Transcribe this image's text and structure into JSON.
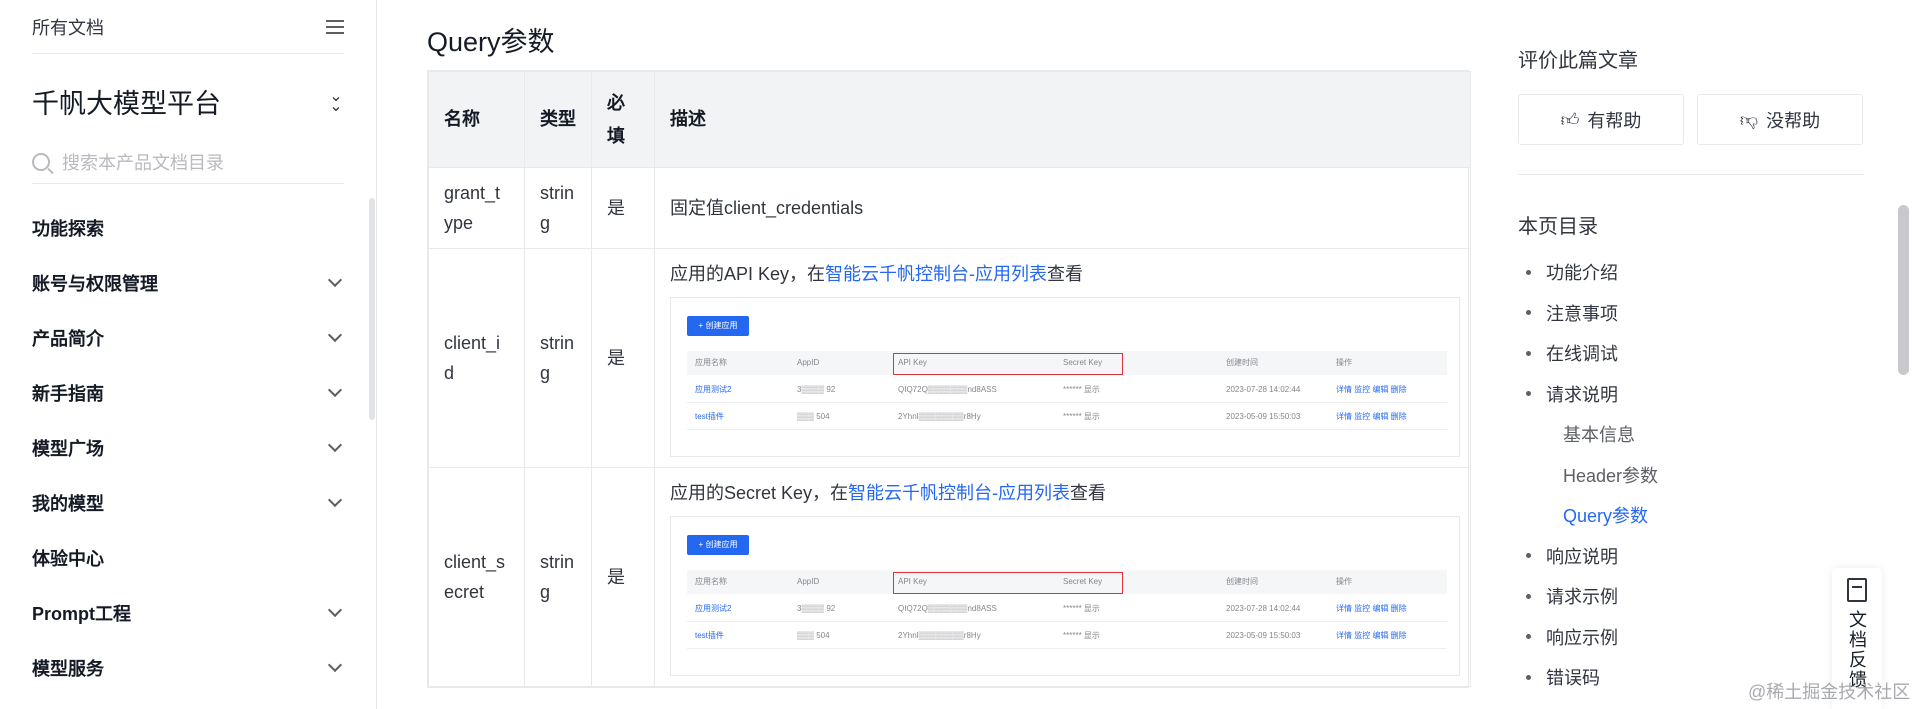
{
  "sidebar": {
    "top_label": "所有文档",
    "product_title": "千帆大模型平台",
    "search_placeholder": "搜索本产品文档目录",
    "items": [
      {
        "label": "功能探索",
        "expandable": false
      },
      {
        "label": "账号与权限管理",
        "expandable": true
      },
      {
        "label": "产品简介",
        "expandable": true
      },
      {
        "label": "新手指南",
        "expandable": true
      },
      {
        "label": "模型广场",
        "expandable": true
      },
      {
        "label": "我的模型",
        "expandable": true
      },
      {
        "label": "体验中心",
        "expandable": false
      },
      {
        "label": "Prompt工程",
        "expandable": true
      },
      {
        "label": "模型服务",
        "expandable": true
      }
    ]
  },
  "main": {
    "section_title": "Query参数",
    "table": {
      "headers": [
        "名称",
        "类型",
        "必填",
        "描述"
      ],
      "rows": [
        {
          "name": "grant_type",
          "type": "string",
          "required": "是",
          "desc_text": "固定值client_credentials"
        },
        {
          "name": "client_id",
          "type": "string",
          "required": "是",
          "desc_prefix": "应用的API Key，在",
          "desc_link": "智能云千帆控制台-应用列表",
          "desc_suffix": "查看"
        },
        {
          "name": "client_secret",
          "type": "string",
          "required": "是",
          "desc_prefix": "应用的Secret Key，在",
          "desc_link": "智能云千帆控制台-应用列表",
          "desc_suffix": "查看"
        }
      ]
    },
    "screenshot": {
      "create_button": "+ 创建应用",
      "columns": [
        "应用名称",
        "AppID",
        "API Key",
        "Secret Key",
        "创建时间",
        "操作"
      ],
      "rows": [
        {
          "name": "应用测试2",
          "appid": "3▒▒▒▒ 92",
          "api_key": "QIQ72Q▒▒▒▒▒▒▒nd8ASS",
          "secret": "****** 显示",
          "created": "2023-07-28 14:02:44",
          "actions": "详情 监控 编辑 删除"
        },
        {
          "name": "test插件",
          "appid": "▒▒▒ 504",
          "api_key": "2Yhnl▒▒▒▒▒▒▒▒r8Hy",
          "secret": "****** 显示",
          "created": "2023-05-09 15:50:03",
          "actions": "详情 监控 编辑 删除"
        }
      ]
    }
  },
  "right": {
    "rate_title": "评价此篇文章",
    "helpful_label": "有帮助",
    "not_helpful_label": "没帮助",
    "toc_title": "本页目录",
    "toc": [
      {
        "label": "功能介绍",
        "level": 1
      },
      {
        "label": "注意事项",
        "level": 1
      },
      {
        "label": "在线调试",
        "level": 1
      },
      {
        "label": "请求说明",
        "level": 1
      },
      {
        "label": "基本信息",
        "level": 2
      },
      {
        "label": "Header参数",
        "level": 2
      },
      {
        "label": "Query参数",
        "level": 2,
        "active": true
      },
      {
        "label": "响应说明",
        "level": 1
      },
      {
        "label": "请求示例",
        "level": 1
      },
      {
        "label": "响应示例",
        "level": 1
      },
      {
        "label": "错误码",
        "level": 1
      }
    ]
  },
  "feedback": {
    "label": "文档反馈"
  },
  "watermark": "@稀土掘金技术社区",
  "colors": {
    "accent": "#2468f2",
    "header_bg": "#f1f3f5",
    "highlight_red": "#e0313c"
  }
}
